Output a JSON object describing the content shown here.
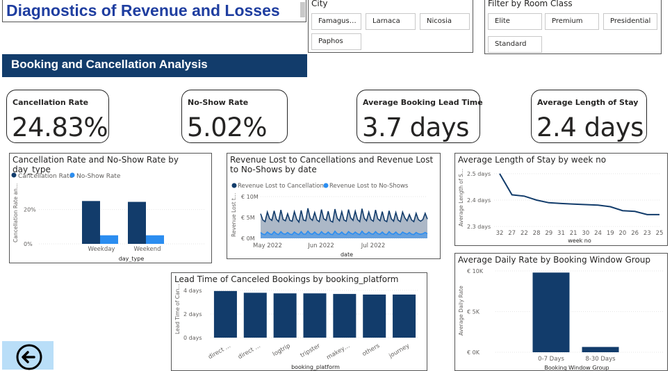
{
  "header": {
    "title": "Diagnostics of Revenue and Losses"
  },
  "city_filter": {
    "title": "City",
    "options": [
      "Famagus…",
      "Larnaca",
      "Nicosia",
      "Paphos"
    ]
  },
  "room_filter": {
    "title": "Filter by Room Class",
    "options": [
      "Elite",
      "Premium",
      "Presidential",
      "Standard"
    ]
  },
  "section": {
    "title": "Booking and Cancellation Analysis"
  },
  "kpis": [
    {
      "label": "Cancellation Rate",
      "value": "24.83%"
    },
    {
      "label": "No-Show Rate",
      "value": "5.02%"
    },
    {
      "label": "Average Booking Lead Time",
      "value": "3.7 days"
    },
    {
      "label": "Average Length of Stay",
      "value": "2.4 days"
    }
  ],
  "colors": {
    "dark_blue": "#123c6b",
    "light_blue": "#2b8df0",
    "area_fill": "#a8b4c4",
    "title_blue": "#1f3ea0",
    "back_button": "#b9def8"
  },
  "icons": {
    "back": "arrow-left-circle-icon"
  },
  "chart_data": [
    {
      "id": "cancel_noshow_daytype",
      "type": "bar",
      "title": "Cancellation Rate and No-Show Rate by day_type",
      "legend": [
        "Cancellation Rate",
        "No-Show Rate"
      ],
      "categories": [
        "Weekday",
        "Weekend"
      ],
      "series": [
        {
          "name": "Cancellation Rate",
          "values": [
            25,
            24.5
          ]
        },
        {
          "name": "No-Show Rate",
          "values": [
            5,
            5
          ]
        }
      ],
      "xlabel": "day_type",
      "ylabel": "Cancellation Rate an…",
      "yticks": [
        "0%",
        "20%"
      ],
      "ylim": [
        0,
        30
      ]
    },
    {
      "id": "revenue_lost_date",
      "type": "area",
      "title": "Revenue Lost to Cancellations and Revenue Lost to No-Shows by date",
      "legend": [
        "Revenue Lost to Cancellations",
        "Revenue Lost to No-Shows"
      ],
      "xlabel": "date",
      "ylabel": "Revenue Lost t…",
      "xticks": [
        "May 2022",
        "Jun 2022",
        "Jul 2022"
      ],
      "yticks": [
        "€ 0M",
        "€ 5M",
        "€ 10M"
      ],
      "ylim": [
        0,
        10
      ],
      "series": [
        {
          "name": "Revenue Lost to Cancellations",
          "values": [
            5.9,
            4.4,
            4.0,
            6.3,
            4.7,
            4.3,
            6.6,
            4.6,
            4.0,
            6.8,
            4.5,
            4.2,
            5.9,
            4.3,
            4.1,
            6.4,
            4.6,
            3.9,
            6.7,
            4.4,
            4.2,
            7.2,
            4.8,
            4.3,
            6.2,
            4.4,
            4.0,
            6.9,
            4.7,
            4.3,
            6.5,
            4.2,
            3.9,
            7.0,
            4.8,
            4.2,
            6.4,
            4.4,
            4.1,
            6.9,
            4.9,
            4.3,
            6.5,
            4.5,
            4.0,
            7.1,
            4.8,
            4.2,
            6.3,
            4.5,
            4.1,
            6.8,
            4.7,
            4.2,
            6.4,
            4.3,
            4.0,
            6.6,
            4.7,
            4.1,
            6.2,
            4.4,
            4.0,
            6.3,
            4.9,
            4.2,
            5.7,
            4.4,
            4.0,
            6.0,
            4.5,
            4.1,
            4.5,
            6.0,
            4.6
          ]
        },
        {
          "name": "Revenue Lost to No-Shows",
          "values": [
            1.4,
            1.0,
            0.9,
            1.5,
            1.1,
            0.9,
            1.6,
            1.1,
            0.9,
            1.6,
            1.1,
            1.0,
            1.4,
            1.0,
            0.9,
            1.5,
            1.1,
            0.9,
            1.6,
            1.0,
            1.0,
            1.7,
            1.1,
            1.0,
            1.5,
            1.0,
            0.9,
            1.6,
            1.1,
            1.0,
            1.5,
            1.0,
            0.9,
            1.7,
            1.1,
            1.0,
            1.5,
            1.0,
            0.9,
            1.6,
            1.2,
            1.0,
            1.5,
            1.1,
            0.9,
            1.7,
            1.1,
            1.0,
            1.5,
            1.1,
            1.0,
            1.6,
            1.1,
            1.0,
            1.5,
            1.0,
            0.9,
            1.6,
            1.1,
            1.0,
            1.5,
            1.0,
            0.9,
            1.5,
            1.2,
            1.0,
            1.4,
            1.0,
            0.9,
            1.4,
            1.1,
            1.0,
            1.1,
            1.4,
            1.1
          ]
        }
      ]
    },
    {
      "id": "stay_by_week",
      "type": "line",
      "title": "Average Length of Stay by week no",
      "categories": [
        "32",
        "27",
        "22",
        "28",
        "29",
        "31",
        "21",
        "30",
        "24",
        "19",
        "20",
        "26",
        "23",
        "25"
      ],
      "values": [
        2.5,
        2.42,
        2.415,
        2.4,
        2.39,
        2.387,
        2.385,
        2.383,
        2.381,
        2.375,
        2.36,
        2.357,
        2.345,
        2.345
      ],
      "xlabel": "week no",
      "ylabel": "Average Length of S…",
      "yticks": [
        "2.3 days",
        "2.4 days",
        "2.5 days"
      ],
      "ylim": [
        2.3,
        2.5
      ]
    },
    {
      "id": "leadtime_platform",
      "type": "bar",
      "title": "Lead Time of Canceled Bookings by booking_platform",
      "categories": [
        "direct …",
        "direct …",
        "logtrip",
        "tripster",
        "makey…",
        "others",
        "journey"
      ],
      "values": [
        3.95,
        3.8,
        3.75,
        3.75,
        3.7,
        3.65,
        3.65
      ],
      "xlabel": "booking_platform",
      "ylabel": "Lead Time of Can…",
      "yticks": [
        "0 days",
        "2 days",
        "4 days"
      ],
      "ylim": [
        0,
        4
      ]
    },
    {
      "id": "adr_window",
      "type": "bar",
      "title": "Average Daily Rate by Booking Window Group",
      "categories": [
        "0-7 Days",
        "8-30 Days"
      ],
      "values": [
        9800,
        650
      ],
      "xlabel": "Booking Window Group",
      "ylabel": "Average Daily Rate",
      "yticks": [
        "€ 0K",
        "€ 5K",
        "€ 10K"
      ],
      "ylim": [
        0,
        10000
      ]
    }
  ]
}
